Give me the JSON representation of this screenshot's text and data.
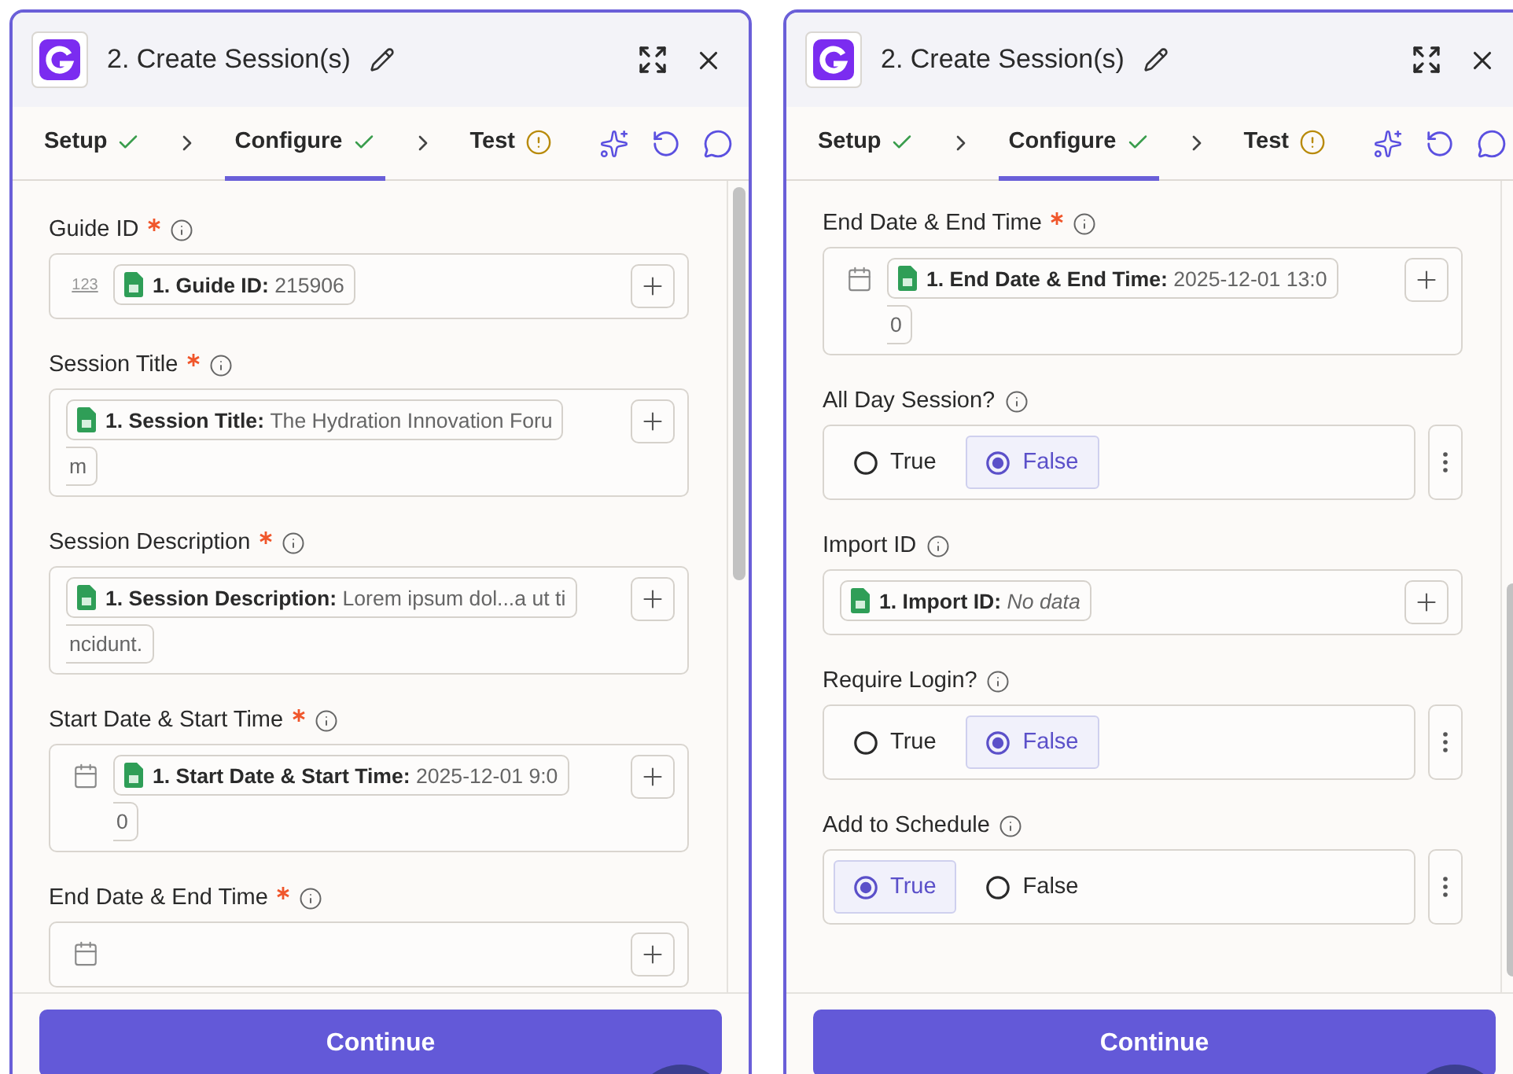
{
  "panels": [
    {
      "title": "2. Create Session(s)",
      "scrolled": false,
      "tabs": [
        {
          "label": "Setup",
          "complete": true,
          "selected": false
        },
        {
          "label": "Configure",
          "complete": true,
          "selected": true
        },
        {
          "label": "Test",
          "complete": false,
          "selected": false
        }
      ],
      "fields": [
        {
          "kind": "mapped",
          "label": "Guide ID",
          "required": true,
          "prefix": {
            "kind": "number",
            "text": "123"
          },
          "chip": {
            "key": "1. Guide ID:",
            "value": "215906",
            "italic": false
          }
        },
        {
          "kind": "mapped",
          "label": "Session Title",
          "required": true,
          "chip": {
            "key": "1. Session Title:",
            "value": "The Hydration Innovation Foru",
            "italic": false,
            "continued": "m"
          }
        },
        {
          "kind": "mapped",
          "label": "Session Description",
          "required": true,
          "chip": {
            "key": "1. Session Description:",
            "value": "Lorem ipsum dol...a ut ti",
            "italic": false,
            "continued": "ncidunt."
          }
        },
        {
          "kind": "mapped",
          "label": "Start Date & Start Time",
          "required": true,
          "prefix": {
            "kind": "date"
          },
          "chip": {
            "key": "1. Start Date & Start Time:",
            "value": "2025-12-01 9:0",
            "italic": false,
            "continued": "0"
          }
        },
        {
          "kind": "mapped",
          "label": "End Date & End Time",
          "required": true,
          "prefix": {
            "kind": "date"
          }
        }
      ],
      "button": "Continue"
    },
    {
      "title": "2. Create Session(s)",
      "scrolled": true,
      "tabs": [
        {
          "label": "Setup",
          "complete": true,
          "selected": false
        },
        {
          "label": "Configure",
          "complete": true,
          "selected": true
        },
        {
          "label": "Test",
          "complete": false,
          "selected": false
        }
      ],
      "fields": [
        {
          "kind": "mapped",
          "label": "End Date & End Time",
          "required": true,
          "prefix": {
            "kind": "date"
          },
          "chip": {
            "key": "1. End Date & End Time:",
            "value": "2025-12-01 13:0",
            "italic": false,
            "continued": "0"
          }
        },
        {
          "kind": "radio",
          "label": "All Day Session?",
          "required": false,
          "options": [
            {
              "label": "True",
              "selected": false
            },
            {
              "label": "False",
              "selected": true
            }
          ]
        },
        {
          "kind": "mapped",
          "label": "Import ID",
          "required": false,
          "chip": {
            "key": "1. Import ID:",
            "value": "No data",
            "italic": true
          }
        },
        {
          "kind": "radio",
          "label": "Require Login?",
          "required": false,
          "options": [
            {
              "label": "True",
              "selected": false
            },
            {
              "label": "False",
              "selected": true
            }
          ]
        },
        {
          "kind": "radio",
          "label": "Add to Schedule",
          "required": false,
          "options": [
            {
              "label": "True",
              "selected": true
            },
            {
              "label": "False",
              "selected": false
            }
          ]
        }
      ],
      "button": "Continue"
    }
  ]
}
